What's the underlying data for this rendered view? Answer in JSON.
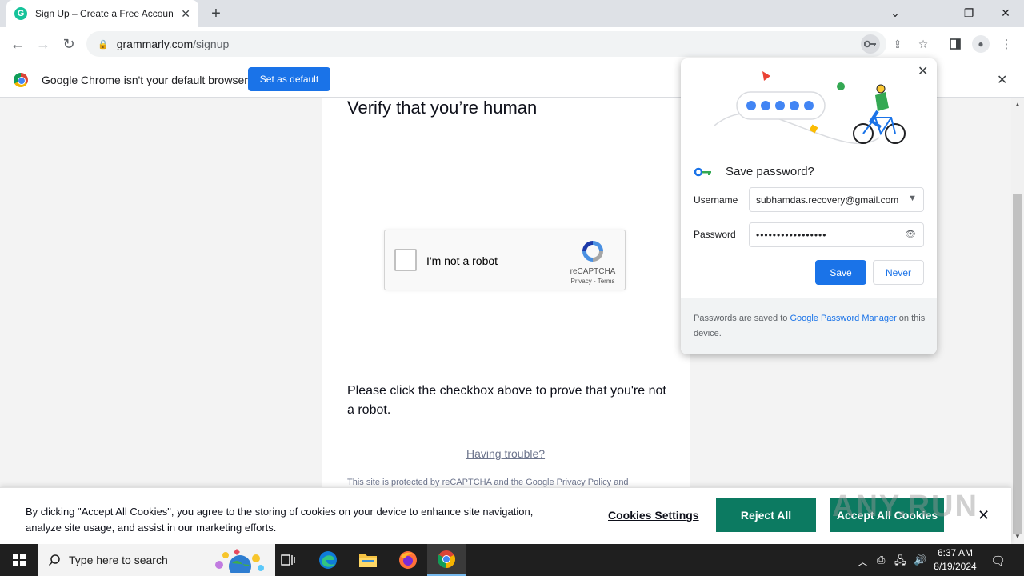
{
  "browser": {
    "tab_title": "Sign Up – Create a Free Account",
    "tab_favicon_letter": "G",
    "url_host": "grammarly.com",
    "url_path": "/signup"
  },
  "infobar": {
    "message": "Google Chrome isn't your default browser",
    "button": "Set as default"
  },
  "page": {
    "heading": "Verify that you’re human",
    "recaptcha": {
      "label": "I'm not a robot",
      "brand": "reCAPTCHA",
      "links": "Privacy - Terms"
    },
    "instruction": "Please click the checkbox above to prove that you're not a robot.",
    "trouble_link": "Having trouble?",
    "protected_text": "This site is protected by reCAPTCHA and the Google Privacy Policy and"
  },
  "cookie_banner": {
    "text": "By clicking \"Accept All Cookies\", you agree to the storing of cookies on your device to enhance site navigation, analyze site usage, and assist in our marketing efforts.",
    "settings_label": "Cookies Settings",
    "reject_label": "Reject All",
    "accept_label": "Accept All Cookies",
    "watermark": "ANY.RUN"
  },
  "password_bubble": {
    "title": "Save password?",
    "username_label": "Username",
    "username_value": "subhamdas.recovery@gmail.com",
    "password_label": "Password",
    "password_value": "•••••••••••••••••",
    "save_label": "Save",
    "never_label": "Never",
    "footer_prefix": "Passwords are saved to ",
    "footer_link": "Google Password Manager",
    "footer_suffix": " on this device."
  },
  "taskbar": {
    "search_placeholder": "Type here to search",
    "time": "6:37 AM",
    "date": "8/19/2024"
  },
  "colors": {
    "chrome_blue": "#1a73e8",
    "grammarly_green": "#15c39a",
    "cookie_button": "#0c7a61"
  }
}
